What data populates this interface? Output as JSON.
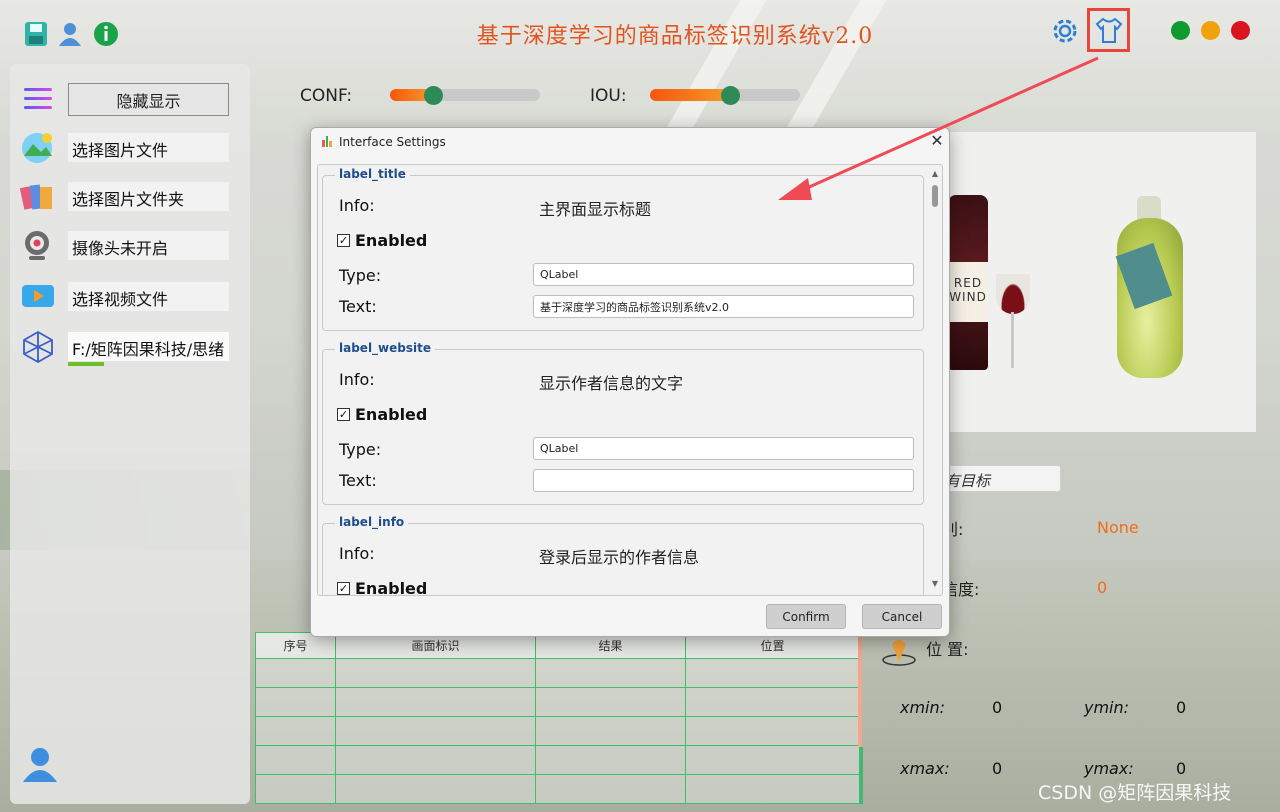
{
  "app": {
    "title": "基于深度学习的商品标签识别系统v2.0",
    "watermark": "CSDN @矩阵因果科技",
    "window_dots": [
      "#0e9a2d",
      "#f0a10b",
      "#d8141f"
    ],
    "accent": "#e2541f"
  },
  "toolbar": {
    "icons": [
      "save-icon",
      "user-icon",
      "info-icon",
      "settings-gear-icon",
      "tshirt-skin-icon"
    ]
  },
  "sidebar": {
    "toggle_label": "隐藏显示",
    "items": [
      {
        "label": "选择图片文件",
        "icon": "image-file-icon"
      },
      {
        "label": "选择图片文件夹",
        "icon": "folder-icon"
      },
      {
        "label": "摄像头未开启",
        "icon": "camera-icon"
      },
      {
        "label": "选择视频文件",
        "icon": "video-icon"
      },
      {
        "label": "F:/矩阵因果科技/思绪",
        "icon": "model-cube-icon"
      }
    ]
  },
  "sliders": {
    "conf_label": "CONF:",
    "conf_value": 0.25,
    "iou_label": "IOU:",
    "iou_value": 0.5
  },
  "results": {
    "target_select": "有目标",
    "class_label": "别:",
    "class_value": "None",
    "confidence_label": "信度:",
    "confidence_value": "0",
    "position_label": "位 置:",
    "xmin_label": "xmin:",
    "xmin_value": "0",
    "ymin_label": "ymin:",
    "ymin_value": "0",
    "xmax_label": "xmax:",
    "xmax_value": "0",
    "ymax_label": "ymax:",
    "ymax_value": "0"
  },
  "table": {
    "headers": [
      "序号",
      "画面标识",
      "结果",
      "位置"
    ],
    "row_count": 5
  },
  "image_panel": {
    "bottle_label_line1": "RED",
    "bottle_label_line2": "WIND"
  },
  "dialog": {
    "title": "Interface Settings",
    "groups": [
      {
        "name": "label_title",
        "info_label": "Info:",
        "info": "主界面显示标题",
        "enabled_label": "Enabled",
        "enabled": true,
        "type_label": "Type:",
        "type": "QLabel",
        "text_label": "Text:",
        "text": "基于深度学习的商品标签识别系统v2.0"
      },
      {
        "name": "label_website",
        "info_label": "Info:",
        "info": "显示作者信息的文字",
        "enabled_label": "Enabled",
        "enabled": true,
        "type_label": "Type:",
        "type": "QLabel",
        "text_label": "Text:",
        "text": ""
      },
      {
        "name": "label_info",
        "info_label": "Info:",
        "info": "登录后显示的作者信息",
        "enabled_label": "Enabled",
        "enabled": true
      }
    ],
    "confirm_label": "Confirm",
    "cancel_label": "Cancel"
  }
}
